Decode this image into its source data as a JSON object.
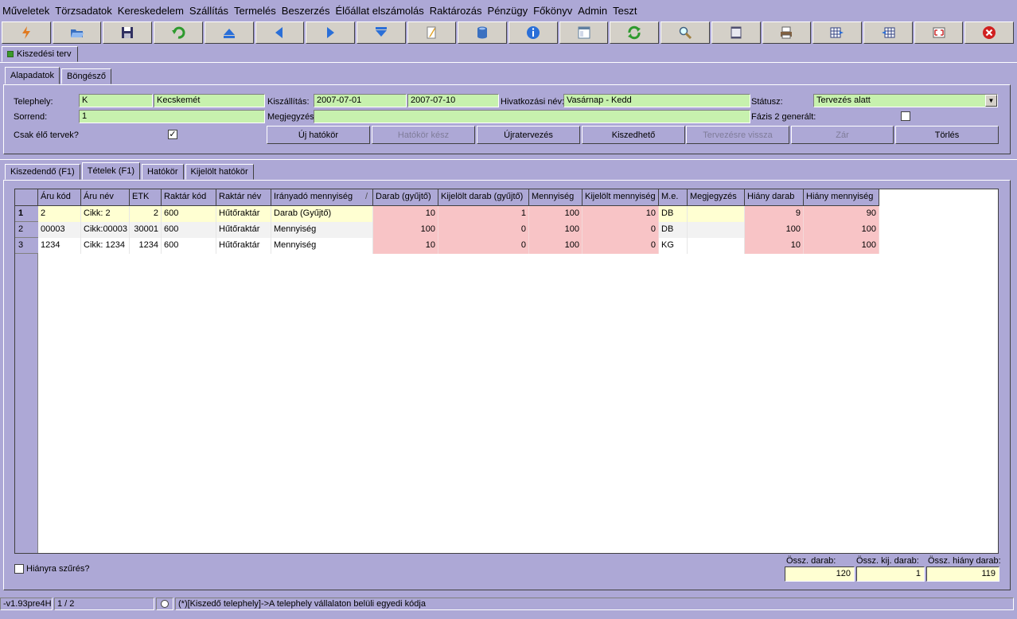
{
  "menu": [
    "Műveletek",
    "Törzsadatok",
    "Kereskedelem",
    "Szállítás",
    "Termelés",
    "Beszerzés",
    "Élőállat elszámolás",
    "Raktározás",
    "Pénzügy",
    "Főkönyv",
    "Admin",
    "Teszt"
  ],
  "toolbar": [
    {
      "name": "lightning-icon",
      "color": "#E07A20"
    },
    {
      "name": "open-folder-icon",
      "color": "#3A70C0"
    },
    {
      "name": "save-disk-icon",
      "color": "#303060"
    },
    {
      "name": "undo-arrow-icon",
      "color": "#2E9A2E"
    },
    {
      "name": "first-record-icon",
      "color": "#2A6FD8"
    },
    {
      "name": "previous-record-icon",
      "color": "#2A6FD8"
    },
    {
      "name": "next-record-icon",
      "color": "#2A6FD8"
    },
    {
      "name": "last-record-icon",
      "color": "#2A6FD8"
    },
    {
      "name": "edit-pencil-icon",
      "color": "#E0A020"
    },
    {
      "name": "database-icon",
      "color": "#3A70C0"
    },
    {
      "name": "info-icon",
      "color": "#2A6FD8"
    },
    {
      "name": "form-view-icon",
      "color": "#6080A0"
    },
    {
      "name": "refresh-icon",
      "color": "#2E9A2E"
    },
    {
      "name": "search-icon",
      "color": "#A08040"
    },
    {
      "name": "columns-icon",
      "color": "#505070"
    },
    {
      "name": "print-icon",
      "color": "#806040"
    },
    {
      "name": "grid-export-icon",
      "color": "#304080"
    },
    {
      "name": "grid-import-icon",
      "color": "#304080"
    },
    {
      "name": "fullscreen-icon",
      "color": "#D03030"
    },
    {
      "name": "close-icon",
      "color": "#D02020"
    }
  ],
  "doc_tab": "Kiszedési terv",
  "top_tabs": [
    "Alapadatok",
    "Böngésző"
  ],
  "form": {
    "telephely_label": "Telephely:",
    "telephely_code": "K",
    "telephely_name": "Kecskemét",
    "sorrend_label": "Sorrend:",
    "sorrend_value": "1",
    "csak_elo_label": "Csak élő tervek?",
    "csak_elo_checked": "✓",
    "kiszallitas_label": "Kiszállítás:",
    "kiszallitas_from": "2007-07-01",
    "kiszallitas_to": "2007-07-10",
    "megjegyzes_label": "Megjegyzés:",
    "megjegyzes_value": "",
    "hivatkozasi_label": "Hivatkozási név:",
    "hivatkozasi_value": "Vasárnap - Kedd",
    "statusz_label": "Státusz:",
    "statusz_value": "Tervezés alatt",
    "fazis2_label": "Fázis 2 generált:"
  },
  "buttons": [
    {
      "label": "Új hatókör",
      "enabled": true
    },
    {
      "label": "Hatókör kész",
      "enabled": false
    },
    {
      "label": "Újratervezés",
      "enabled": true
    },
    {
      "label": "Kiszedhető",
      "enabled": true
    },
    {
      "label": "Tervezésre vissza",
      "enabled": false
    },
    {
      "label": "Zár",
      "enabled": false
    },
    {
      "label": "Törlés",
      "enabled": true
    }
  ],
  "lower_tabs": [
    "Kiszedendő (F1)",
    "Tételek (F1)",
    "Hatókör",
    "Kijelölt hatókör"
  ],
  "grid": {
    "columns": [
      "Áru kód",
      "Áru név",
      "ETK",
      "Raktár kód",
      "Raktár név",
      "Irányadó mennyiség",
      "Darab (gyűjtő)",
      "Kijelölt darab (gyűjtő)",
      "Mennyiség",
      "Kijelölt mennyiség",
      "M.e.",
      "Megjegyzés",
      "Hiány darab",
      "Hiány mennyiség"
    ],
    "sort_indicator": "/",
    "rows": [
      {
        "n": "1",
        "cells": [
          "2",
          "Cikk: 2",
          "2",
          "600",
          "Hűtőraktár",
          "Darab (Gyűjtő)",
          "10",
          "1",
          "100",
          "10",
          "DB",
          "",
          "9",
          "90"
        ]
      },
      {
        "n": "2",
        "cells": [
          "00003",
          "Cikk:00003",
          "30001",
          "600",
          "Hűtőraktár",
          "Mennyiség",
          "100",
          "0",
          "100",
          "0",
          "DB",
          "",
          "100",
          "100"
        ]
      },
      {
        "n": "3",
        "cells": [
          "1234",
          "Cikk: 1234",
          "1234",
          "600",
          "Hűtőraktár",
          "Mennyiség",
          "10",
          "0",
          "100",
          "0",
          "KG",
          "",
          "10",
          "100"
        ]
      }
    ]
  },
  "hianyra_label": "Hiányra szűrés?",
  "totals": [
    {
      "label": "Össz. darab:",
      "value": "120"
    },
    {
      "label": "Össz. kij. darab:",
      "value": "1"
    },
    {
      "label": "Össz. hiány darab:",
      "value": "119"
    }
  ],
  "status": {
    "version": "-v1.93pre4H",
    "page": "1 / 2",
    "message": "(*)[Kiszedő telephely]->A telephely vállalaton belüli egyedi kódja"
  }
}
